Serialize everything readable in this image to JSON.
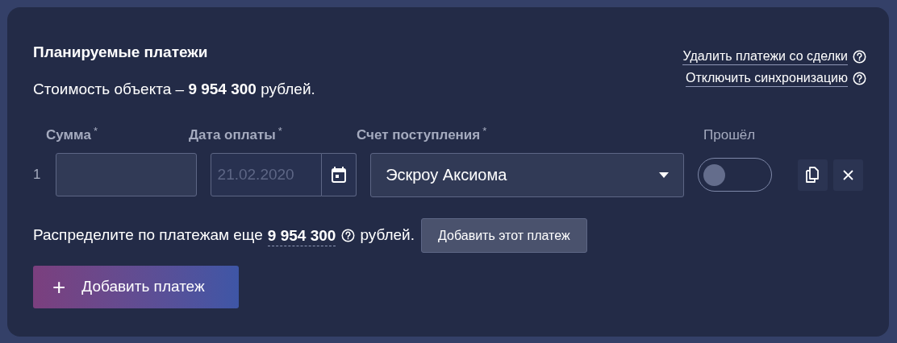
{
  "title": "Планируемые платежи",
  "cost_text": "Стоимость объекта – **9 954 300** рублей.",
  "links": [
    {
      "label": "Удалить платежи со сделки"
    },
    {
      "label": "Отключить синхронизацию"
    }
  ],
  "columns": [
    {
      "label": "Сумма",
      "marker": "*"
    },
    {
      "label": "Дата оплаты",
      "marker": "*"
    },
    {
      "label": "Счет поступления",
      "marker": "*"
    },
    {
      "label": "Прошёл"
    }
  ],
  "payments": [
    {
      "index": "1",
      "date_placeholder": "21.02.2020",
      "account": "Эскроу Аксиома",
      "passed": false
    }
  ],
  "remaining": {
    "prefix": "Распределите по платежам еще",
    "amount": "9 954 300",
    "suffix": "рублей.",
    "button": "Добавить этот платеж"
  },
  "add_button": {
    "icon": "+",
    "label": "Добавить платеж"
  }
}
